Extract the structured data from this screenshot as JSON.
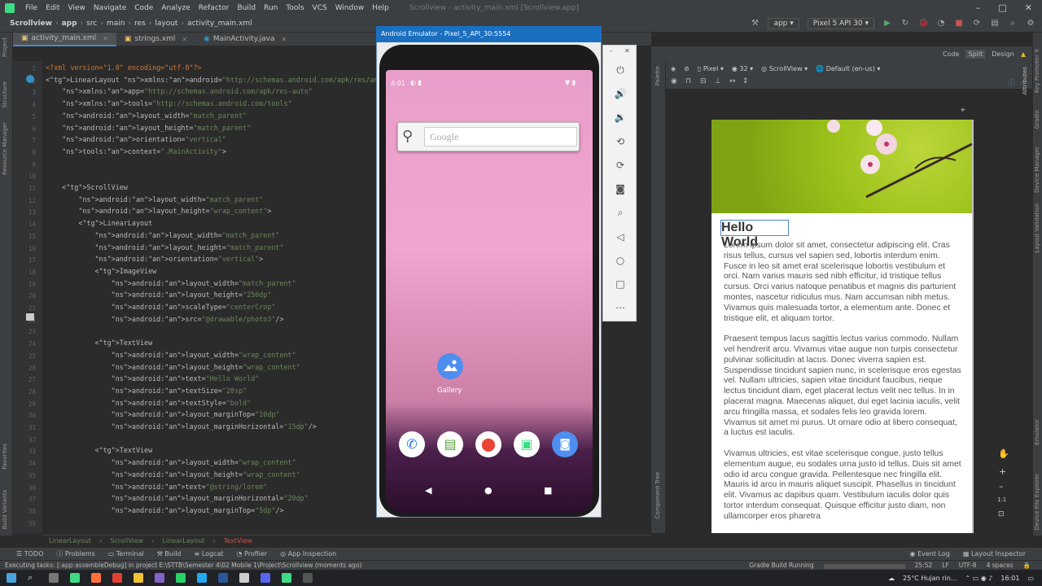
{
  "menu": {
    "items": [
      "File",
      "Edit",
      "View",
      "Navigate",
      "Code",
      "Analyze",
      "Refactor",
      "Build",
      "Run",
      "Tools",
      "VCS",
      "Window",
      "Help"
    ],
    "window_title": "Scrollview - activity_main.xml [Scrollview.app]"
  },
  "nav": {
    "crumbs": [
      "Scrollview",
      "app",
      "src",
      "main",
      "res",
      "layout",
      "activity_main.xml"
    ],
    "run_config": "app",
    "device": "Pixel 5 API 30"
  },
  "tabs": [
    {
      "label": "activity_main.xml",
      "active": true
    },
    {
      "label": "strings.xml",
      "active": false
    },
    {
      "label": "MainActivity.java",
      "active": false
    }
  ],
  "left_labels": [
    "Project",
    "Structure",
    "Resource Manager",
    "Favorites",
    "Build Variants"
  ],
  "code": {
    "lines": [
      {
        "n": "1",
        "text": "<?xml version=\"1.0\" encoding=\"utf-8\"?>"
      },
      {
        "n": "2",
        "text": "<LinearLayout xmlns:android=\"http://schemas.android.com/apk/res/android\""
      },
      {
        "n": "3",
        "text": "    xmlns:app=\"http://schemas.android.com/apk/res-auto\""
      },
      {
        "n": "4",
        "text": "    xmlns:tools=\"http://schemas.android.com/tools\""
      },
      {
        "n": "5",
        "text": "    android:layout_width=\"match_parent\""
      },
      {
        "n": "6",
        "text": "    android:layout_height=\"match_parent\""
      },
      {
        "n": "7",
        "text": "    android:orientation=\"vertical\""
      },
      {
        "n": "8",
        "text": "    tools:context=\".MainActivity\">"
      },
      {
        "n": "9",
        "text": ""
      },
      {
        "n": "10",
        "text": ""
      },
      {
        "n": "11",
        "text": "    <ScrollView"
      },
      {
        "n": "12",
        "text": "        android:layout_width=\"match_parent\""
      },
      {
        "n": "13",
        "text": "        android:layout_height=\"wrap_content\">"
      },
      {
        "n": "14",
        "text": "        <LinearLayout"
      },
      {
        "n": "15",
        "text": "            android:layout_width=\"match_parent\""
      },
      {
        "n": "16",
        "text": "            android:layout_height=\"match_parent\""
      },
      {
        "n": "17",
        "text": "            android:orientation=\"vertical\">"
      },
      {
        "n": "18",
        "text": "            <ImageView"
      },
      {
        "n": "19",
        "text": "                android:layout_width=\"match_parent\""
      },
      {
        "n": "20",
        "text": "                android:layout_height=\"250dp\""
      },
      {
        "n": "21",
        "text": "                android:scaleType=\"centerCrop\""
      },
      {
        "n": "22",
        "text": "                android:src=\"@drawable/photo3\"/>"
      },
      {
        "n": "23",
        "text": ""
      },
      {
        "n": "24",
        "text": "            <TextView"
      },
      {
        "n": "25",
        "text": "                android:layout_width=\"wrap_content\""
      },
      {
        "n": "26",
        "text": "                android:layout_height=\"wrap_content\""
      },
      {
        "n": "27",
        "text": "                android:text=\"Hello World\""
      },
      {
        "n": "28",
        "text": "                android:textSize=\"20sp\""
      },
      {
        "n": "29",
        "text": "                android:textStyle=\"bold\""
      },
      {
        "n": "30",
        "text": "                android:layout_marginTop=\"10dp\""
      },
      {
        "n": "31",
        "text": "                android:layout_marginHorizontal=\"15dp\"/>"
      },
      {
        "n": "32",
        "text": ""
      },
      {
        "n": "33",
        "text": "            <TextView"
      },
      {
        "n": "34",
        "text": "                android:layout_width=\"wrap_content\""
      },
      {
        "n": "35",
        "text": "                android:layout_height=\"wrap_content\""
      },
      {
        "n": "36",
        "text": "                android:text=\"@string/lorem\""
      },
      {
        "n": "37",
        "text": "                android:layout_marginHorizontal=\"20dp\""
      },
      {
        "n": "38",
        "text": "                android:layout_marginTop=\"5dp\"/>"
      },
      {
        "n": "39",
        "text": ""
      }
    ]
  },
  "editor_crumbs": [
    "LinearLayout",
    "ScrollView",
    "LinearLayout",
    "TextView"
  ],
  "emulator": {
    "title": "Android Emulator - Pixel_5_API_30:5554",
    "time": "4:01",
    "search_placeholder": "Google",
    "app_label": "Gallery"
  },
  "design": {
    "view_modes": [
      "Code",
      "Split",
      "Design"
    ],
    "device": "Pixel",
    "api": "32",
    "root": "ScrollView",
    "locale": "Default (en-us)",
    "palette_label": "Palette",
    "component_tree_label": "Component Tree",
    "attributes_label": "Attributes",
    "preview_title": "Hello World",
    "preview_body": "Lorem ipsum dolor sit amet, consectetur adipiscing elit. Cras risus tellus, cursus vel sapien sed, lobortis interdum enim. Fusce in leo sit amet erat scelerisque lobortis vestibulum et orci. Nam varius mauris sed nibh efficitur, id tristique tellus cursus. Orci varius natoque penatibus et magnis dis parturient montes, nascetur ridiculus mus. Nam accumsan nibh metus. Vivamus quis malesuada tortor, a elementum ante. Donec et tristique elit, et aliquam tortor.\n\nPraesent tempus lacus sagittis lectus varius commodo. Nullam vel hendrerit arcu. Vivamus vitae augue non turpis consectetur pulvinar sollicitudin at lacus. Donec viverra sapien est. Suspendisse tincidunt sapien nunc, in scelerisque eros egestas vel. Nullam ultricies, sapien vitae tincidunt faucibus, neque lectus tincidunt diam, eget placerat lectus velit nec tellus. In in placerat magna. Maecenas aliquet, dui eget lacinia iaculis, velit arcu fringilla massa, et sodales felis leo gravida lorem. Vivamus sit amet mi purus. Ut ornare odio at libero consequat, a luctus est iaculis.\n\nVivamus ultricies, est vitae scelerisque congue, justo tellus elementum augue, eu sodales urna justo id tellus. Duis sit amet odio id arcu congue gravida. Pellentesque nec fringilla elit. Mauris id arcu in mauris aliquet suscipit. Phasellus in tincidunt elit. Vivamus ac dapibus quam. Vestibulum iaculis dolor quis tortor interdum consequat. Quisque efficitur justo diam, non ullamcorper eros pharetra",
    "zoom_ratio": "1:1"
  },
  "right_labels": [
    "Key Promoter X",
    "Gradle",
    "Device Manager",
    "Layout Validation",
    "Emulator",
    "Device File Explorer"
  ],
  "bottom_tools": [
    "TODO",
    "Problems",
    "Terminal",
    "Build",
    "Logcat",
    "Profiler",
    "App Inspection"
  ],
  "bottom_tools_right": [
    "Event Log",
    "Layout Inspector"
  ],
  "status": {
    "message": "Executing tasks: [:app:assembleDebug] in project E:\\STTB\\Semester 4\\02 Mobile 1\\Project\\Scrollview (moments ago)",
    "gradle": "Gradle Build Running",
    "position": "25:52",
    "line_sep": "LF",
    "encoding": "UTF-8",
    "indent": "4 spaces"
  },
  "taskbar": {
    "weather": "25°C  Hujan rin...",
    "clock": "16:01"
  }
}
